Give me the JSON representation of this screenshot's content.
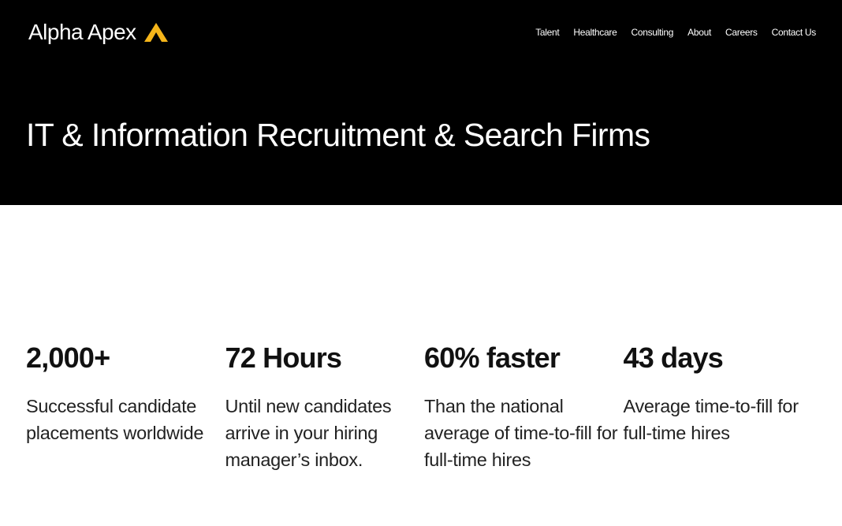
{
  "brand": {
    "name": "Alpha Apex",
    "accent_color": "#F5B51A",
    "logo_icon": "chevron-up-icon"
  },
  "nav": {
    "items": [
      {
        "label": "Talent"
      },
      {
        "label": "Healthcare"
      },
      {
        "label": "Consulting"
      },
      {
        "label": "About"
      },
      {
        "label": "Careers"
      },
      {
        "label": "Contact Us"
      }
    ]
  },
  "hero": {
    "title": "IT & Information Recruitment & Search Firms",
    "background": "#000000"
  },
  "stats": [
    {
      "value": "2,000+",
      "description": "Successful candidate placements worldwide"
    },
    {
      "value": "72 Hours",
      "description": "Until new candidates arrive in your hiring manager’s inbox."
    },
    {
      "value": "60% faster",
      "description": "Than the national average of time-to-fill for full-time hires"
    },
    {
      "value": "43 days",
      "description": "Average time-to-fill for full-time hires"
    }
  ]
}
